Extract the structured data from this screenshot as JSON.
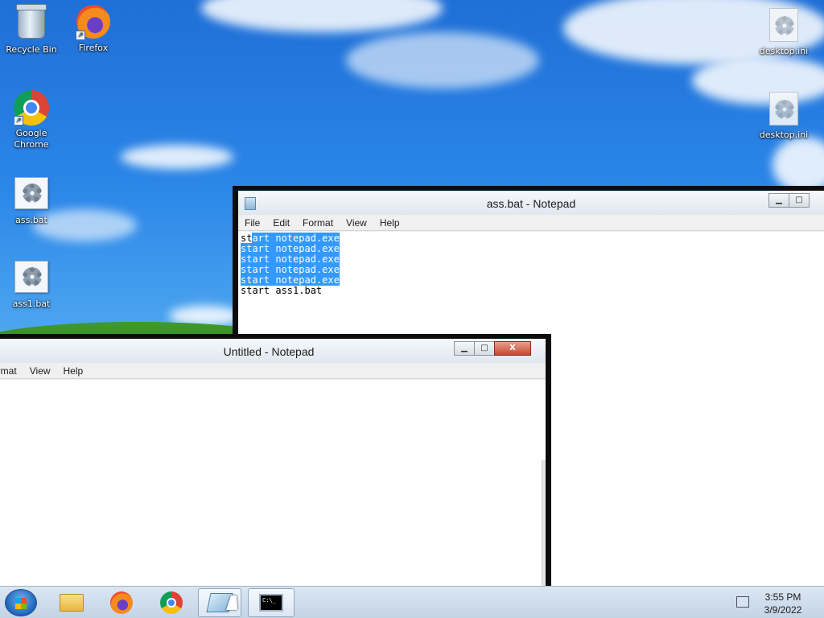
{
  "desktop": {
    "icons": [
      {
        "label": "Recycle Bin",
        "icon": "recycle-bin-icon"
      },
      {
        "label": "Firefox",
        "icon": "firefox-icon"
      },
      {
        "label": "Google Chrome",
        "icon": "chrome-icon"
      },
      {
        "label": "ass.bat",
        "icon": "batch-file-icon"
      },
      {
        "label": "ass1.bat",
        "icon": "batch-file-icon"
      },
      {
        "label": "desktop.ini",
        "icon": "settings-file-icon"
      },
      {
        "label": "desktop.ini",
        "icon": "settings-file-icon"
      }
    ]
  },
  "windows": {
    "back": {
      "title": "ass.bat - Notepad",
      "menu": [
        "File",
        "Edit",
        "Format",
        "View",
        "Help"
      ],
      "lines": [
        {
          "pre": "st",
          "sel": "art notepad.exe"
        },
        {
          "pre": "",
          "sel": "start notepad.exe"
        },
        {
          "pre": "",
          "sel": "start notepad.exe"
        },
        {
          "pre": "",
          "sel": "start notepad.exe"
        },
        {
          "pre": "",
          "sel": "start notepad.exe"
        },
        {
          "pre": "start ass1.bat",
          "sel": ""
        }
      ]
    },
    "front": {
      "title": "Untitled - Notepad",
      "menu": [
        "ormat",
        "View",
        "Help"
      ],
      "content": ""
    }
  },
  "controls": {
    "minimize": "▁",
    "maximize": "□",
    "close": "X"
  },
  "taskbar": {
    "buttons": [
      "start-button",
      "windows-explorer-icon",
      "firefox-icon",
      "chrome-icon",
      "notepad-icon",
      "command-prompt-icon"
    ],
    "cmd_glyph": "C:\\_",
    "time": "3:55 PM",
    "date": "3/9/2022"
  },
  "colors": {
    "selection": "#3399ff",
    "close": "#c7472f"
  }
}
